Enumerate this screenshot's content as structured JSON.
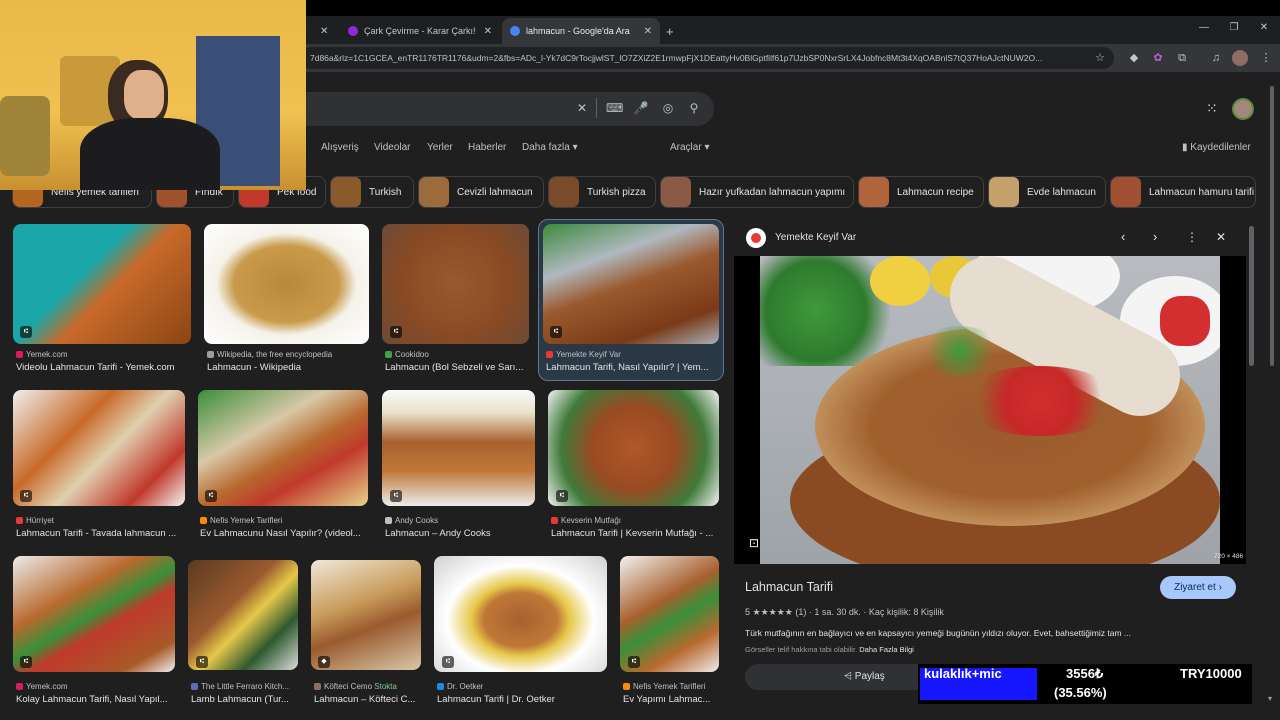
{
  "tabs": [
    {
      "label": "Çark Çevirme - Karar Çarkı!",
      "close": "✕",
      "color": "#8a2be2"
    },
    {
      "label": "lahmacun - Google'da Ara",
      "close": "✕",
      "color": "#4285f4"
    }
  ],
  "new_tab": "+",
  "window": {
    "minimize": "—",
    "restore": "❐",
    "close": "✕"
  },
  "url": "7d86a&rlz=1C1GCEA_enTR1176TR1176&udm=2&fbs=ADc_l-Yk7dC9rTocjjwlST_lO7ZXiZ2E1rmwpFjX1DEattyHv0BlGptfilf61p7lJzbSP0NxrSrLX4Jobfnc8Mt3t4XqOABnlS7tQ37HoAJctNUW2O...",
  "search": {
    "clear": "✕"
  },
  "nav_items": [
    {
      "label": "Alışveriş"
    },
    {
      "label": "Videolar"
    },
    {
      "label": "Yerler"
    },
    {
      "label": "Haberler"
    },
    {
      "label": "Daha fazla ▾"
    },
    {
      "label": "Araçlar ▾"
    }
  ],
  "saved_label": "Kaydedilenler",
  "chips": [
    {
      "label": "Nefis yemek tarifleri"
    },
    {
      "label": "Fındık"
    },
    {
      "label": "Pek food"
    },
    {
      "label": "Turkish"
    },
    {
      "label": "Cevizli lahmacun"
    },
    {
      "label": "Turkish pizza"
    },
    {
      "label": "Hazır yufkadan lahmacun yapımı"
    },
    {
      "label": "Lahmacun recipe"
    },
    {
      "label": "Evde lahmacun"
    },
    {
      "label": "Lahmacun hamuru tarifi"
    }
  ],
  "results": [
    {
      "source": "Yemek.com",
      "title": "Videolu Lahmacun Tarifi - Yemek.com",
      "color": "#d81b60"
    },
    {
      "source": "Wikipedia, the free encyclopedia",
      "title": "Lahmacun - Wikipedia",
      "color": "#9e9e9e"
    },
    {
      "source": "Cookidoo",
      "title": "Lahmacun (Bol Sebzeli ve Sarı...",
      "color": "#43a047"
    },
    {
      "source": "Yemekte Keyif Var",
      "title": "Lahmacun Tarifi, Nasıl Yapılır? | Yem...",
      "color": "#e53935"
    },
    {
      "source": "Hürriyet",
      "title": "Lahmacun Tarifi - Tavada lahmacun ...",
      "color": "#e53935"
    },
    {
      "source": "Nefis Yemek Tarifleri",
      "title": "Ev Lahmacunu Nasıl Yapılır? (videol...",
      "color": "#fb8c00"
    },
    {
      "source": "Andy Cooks",
      "title": "Lahmacun – Andy Cooks",
      "color": "#bdbdbd"
    },
    {
      "source": "Kevserin Mutfağı",
      "title": "Lahmacun Tarifi | Kevserin Mutfağı - ...",
      "color": "#e53935"
    },
    {
      "source": "Yemek.com",
      "title": "Kolay Lahmacun Tarifi, Nasıl Yapıl...",
      "color": "#d81b60"
    },
    {
      "source": "The Little Ferraro Kitch...",
      "title": "Lamb Lahmacun (Tur...",
      "color": "#5c6bc0"
    },
    {
      "source": "Köfteci Cemo",
      "title": "Lahmacun – Köfteci C...",
      "color": "#8d6e63",
      "badge": "Stokta"
    },
    {
      "source": "Dr. Oetker",
      "title": "Lahmacun Tarifi | Dr. Oetker",
      "color": "#1e88e5"
    },
    {
      "source": "Nefis Yemek Tarifleri",
      "title": "Ev Yapımı Lahmac...",
      "color": "#fb8c00"
    }
  ],
  "panel": {
    "site": "Yemekte Keyif Var",
    "size": "720 × 486",
    "title": "Lahmacun Tarifi",
    "visit": "Ziyaret et",
    "rating": "5 ★★★★★ (1)",
    "time": "1 sa. 30 dk.",
    "servings": "Kaç kişilik: 8 Kişilik",
    "description": "Türk mutfağının en bağlayıcı ve en kapsayıcı yemeği bugünün yıldızı oluyor. Evet, bahsettiğimiz tam ...",
    "copyright": "Görseller telif hakkına tabi olabilir.",
    "more": "Daha Fazla Bilgi",
    "share": "Paylaş"
  },
  "overlay": {
    "goal_label": "kulaklık+mic",
    "current": "3556₺",
    "target": "TRY10000",
    "percent": "(35.56%)",
    "progress": 0.3556
  },
  "colors": {
    "accent": "#a8c7fa",
    "bg": "#1f1f1f",
    "progress": "#1616ff"
  }
}
